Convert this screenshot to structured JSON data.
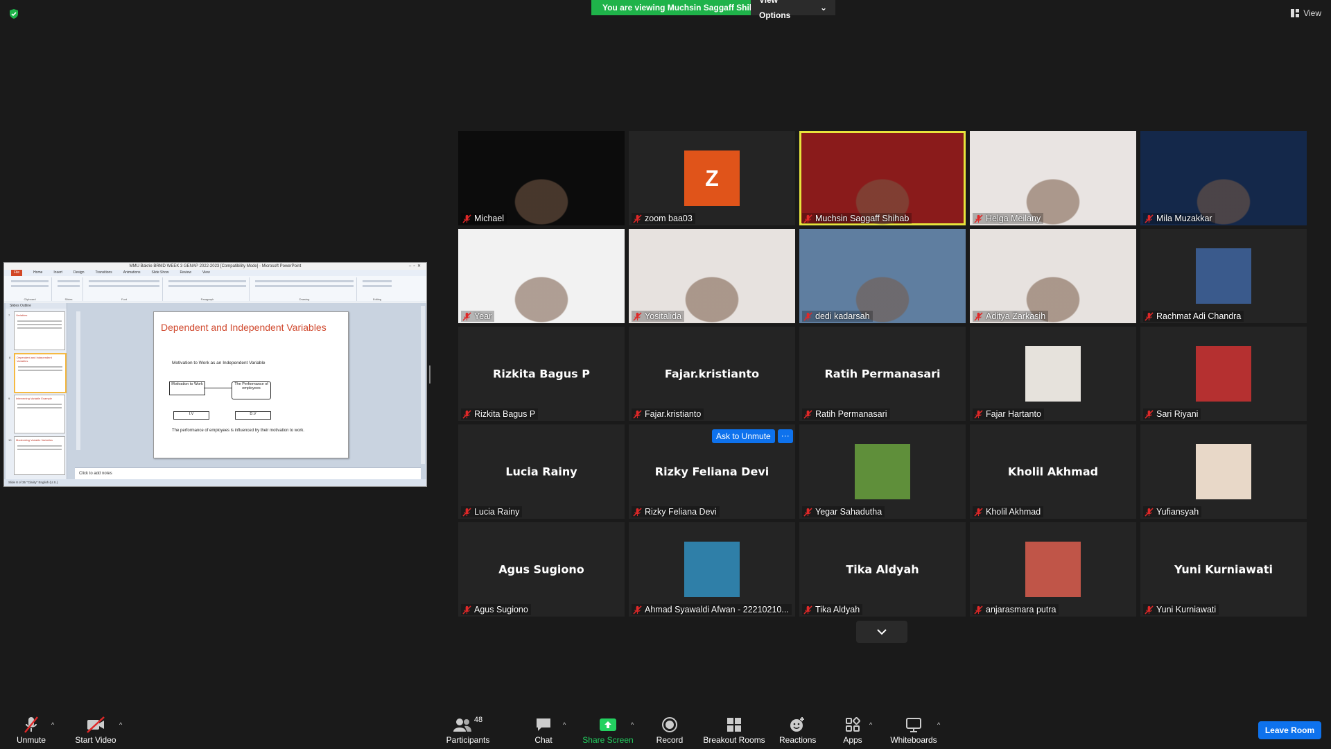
{
  "banner": {
    "viewing_text": "You are viewing Muchsin Saggaff Shihab's screen",
    "view_options_label": "View Options"
  },
  "top_right": {
    "view_label": "View"
  },
  "shared_screen": {
    "window_title": "MMU Bakrie BRMD WEEK 3 GENAP 2022-2023 [Compatibility Mode] - Microsoft PowerPoint",
    "ribbon_tabs": [
      "File",
      "Home",
      "Insert",
      "Design",
      "Transitions",
      "Animations",
      "Slide Show",
      "Review",
      "View"
    ],
    "ribbon_groups": [
      "Clipboard",
      "Slides",
      "Font",
      "Paragraph",
      "Drawing",
      "Editing"
    ],
    "panel_tabs": "Slides   Outline",
    "thumbnails": [
      {
        "num": "7",
        "title": "Variables"
      },
      {
        "num": "8",
        "title": "Dependent and Independent Variables"
      },
      {
        "num": "9",
        "title": "Intervening Variable Example"
      },
      {
        "num": "10",
        "title": "Moderating Variable Variables"
      }
    ],
    "slide": {
      "title": "Dependent and Independent  Variables",
      "subtitle": "Motivation to Work as an Independent  Variable",
      "box_motivation": "Motivation to Work",
      "box_performance": "The Performance of employees",
      "box_iv": "I.V",
      "box_dv": "D.V",
      "conclusion": "The performance of employees is influenced by their motivation to work."
    },
    "notes_placeholder": "Click to add notes",
    "status_text": "Slide 8 of 35     \"Clarity\"     English (U.S.)"
  },
  "participants": [
    {
      "label": "Michael",
      "kind": "video",
      "bg": "#0c0c0c"
    },
    {
      "label": "zoom baa03",
      "kind": "initial",
      "initial": "Z"
    },
    {
      "label": "Muchsin Saggaff Shihab",
      "kind": "video",
      "bg": "#8a1b1b",
      "active": true
    },
    {
      "label": "Helga Meilany",
      "kind": "video",
      "bg": "#e9e4e2"
    },
    {
      "label": "Mila Muzakkar",
      "kind": "video",
      "bg": "#14284a"
    },
    {
      "label": "Year",
      "kind": "video",
      "bg": "#f2f2f2"
    },
    {
      "label": "Yositalida",
      "kind": "video",
      "bg": "#e7e2df"
    },
    {
      "label": "dedi kadarsah",
      "kind": "video",
      "bg": "#5f7ea0"
    },
    {
      "label": "Aditya Zarkasih",
      "kind": "video",
      "bg": "#e7e2df"
    },
    {
      "label": "Rachmat Adi Chandra",
      "kind": "photo",
      "photo_bg": "#3a5a8c"
    },
    {
      "label": "Rizkita Bagus P",
      "kind": "name",
      "display": "Rizkita Bagus P"
    },
    {
      "label": "Fajar.kristianto",
      "kind": "name",
      "display": "Fajar.kristianto"
    },
    {
      "label": "Ratih Permanasari",
      "kind": "name",
      "display": "Ratih Permanasari"
    },
    {
      "label": "Fajar Hartanto",
      "kind": "photo",
      "photo_bg": "#e6e2dc"
    },
    {
      "label": "Sari Riyani",
      "kind": "photo",
      "photo_bg": "#b53030"
    },
    {
      "label": "Lucia Rainy",
      "kind": "name",
      "display": "Lucia Rainy"
    },
    {
      "label": "Rizky Feliana Devi",
      "kind": "name",
      "display": "Rizky Feliana Devi"
    },
    {
      "label": "Yegar Sahadutha",
      "kind": "photo",
      "photo_bg": "#5f8f3a"
    },
    {
      "label": "Kholil Akhmad",
      "kind": "name",
      "display": "Kholil Akhmad"
    },
    {
      "label": "Yufiansyah",
      "kind": "photo",
      "photo_bg": "#e8d8c8"
    },
    {
      "label": "Agus Sugiono",
      "kind": "name",
      "display": "Agus Sugiono"
    },
    {
      "label": "Ahmad Syawaldi Afwan - 22210210...",
      "kind": "photo",
      "photo_bg": "#2f7fa8"
    },
    {
      "label": "Tika Aldyah",
      "kind": "name",
      "display": "Tika Aldyah"
    },
    {
      "label": "anjarasmara putra",
      "kind": "photo",
      "photo_bg": "#c05548"
    },
    {
      "label": "Yuni Kurniawati",
      "kind": "name",
      "display": "Yuni Kurniawati"
    }
  ],
  "ask_to_unmute_label": "Ask to Unmute",
  "more_label": "···",
  "toolbar": {
    "unmute": "Unmute",
    "start_video": "Start Video",
    "participants": "Participants",
    "participants_count": "48",
    "chat": "Chat",
    "share_screen": "Share Screen",
    "record": "Record",
    "breakout_rooms": "Breakout Rooms",
    "reactions": "Reactions",
    "apps": "Apps",
    "whiteboards": "Whiteboards",
    "leave_room": "Leave Room"
  },
  "colors": {
    "banner_green": "#1fb34a",
    "accent_blue": "#0e72ed",
    "active_speaker": "#e8e43c",
    "mute_red": "#e02828",
    "share_green": "#23d160"
  }
}
